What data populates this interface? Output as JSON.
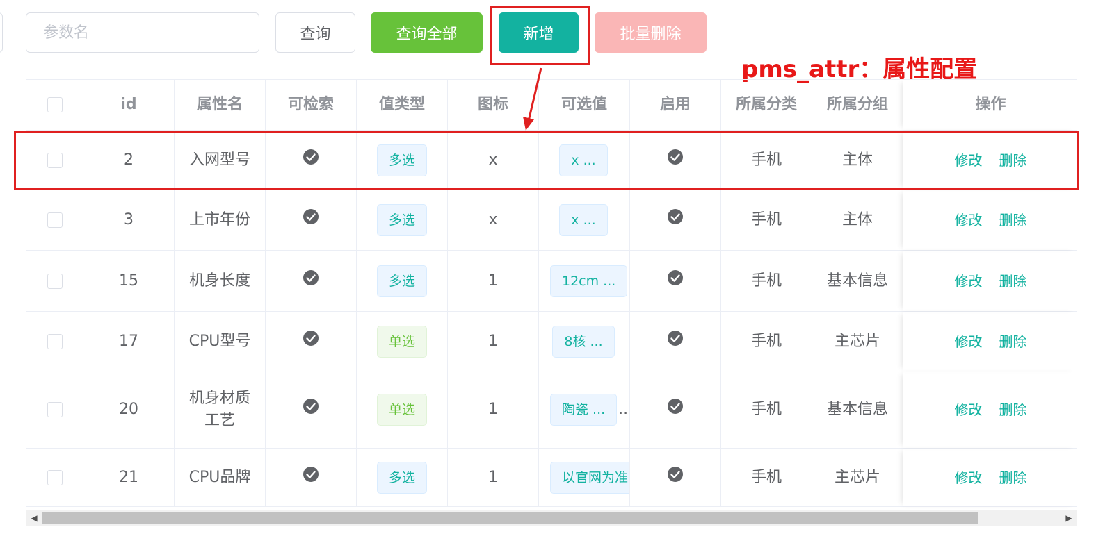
{
  "toolbar": {
    "search_placeholder": "参数名",
    "query_label": "查询",
    "query_all_label": "查询全部",
    "add_label": "新增",
    "batch_delete_label": "批量删除"
  },
  "annotation": {
    "text": "pms_attr：属性配置",
    "color": "#e81818"
  },
  "colors": {
    "primary": "#13b2a0",
    "success": "#67c23a",
    "danger_light": "#fab6b6"
  },
  "table": {
    "headers": [
      "id",
      "属性名",
      "可检索",
      "值类型",
      "图标",
      "可选值",
      "启用",
      "所属分类",
      "所属分组",
      "操作"
    ],
    "rows": [
      {
        "id": "2",
        "name": "入网型号",
        "searchable": "check-circle-icon",
        "type": "多选",
        "type_style": "primary",
        "icon": "x",
        "values": "x ...",
        "values_overflow": "",
        "enabled": "check-circle-icon",
        "category": "手机",
        "group": "主体",
        "edit": "修改",
        "delete": "删除"
      },
      {
        "id": "3",
        "name": "上市年份",
        "searchable": "check-circle-icon",
        "type": "多选",
        "type_style": "primary",
        "icon": "x",
        "values": "x ...",
        "values_overflow": "",
        "enabled": "check-circle-icon",
        "category": "手机",
        "group": "主体",
        "edit": "修改",
        "delete": "删除"
      },
      {
        "id": "15",
        "name": "机身长度",
        "searchable": "check-circle-icon",
        "type": "多选",
        "type_style": "primary",
        "icon": "1",
        "values": "12cm ...",
        "values_overflow": ".",
        "enabled": "check-circle-icon",
        "category": "手机",
        "group": "基本信息",
        "edit": "修改",
        "delete": "删除"
      },
      {
        "id": "17",
        "name": "CPU型号",
        "searchable": "check-circle-icon",
        "type": "单选",
        "type_style": "success",
        "icon": "1",
        "values": "8核 ...",
        "values_overflow": "",
        "enabled": "check-circle-icon",
        "category": "手机",
        "group": "主芯片",
        "edit": "修改",
        "delete": "删除"
      },
      {
        "id": "20",
        "name": "机身材质工艺",
        "searchable": "check-circle-icon",
        "type": "单选",
        "type_style": "success",
        "icon": "1",
        "values": "陶瓷 ...",
        "values_overflow": "..",
        "enabled": "check-circle-icon",
        "category": "手机",
        "group": "基本信息",
        "edit": "修改",
        "delete": "删除"
      },
      {
        "id": "21",
        "name": "CPU品牌",
        "searchable": "check-circle-icon",
        "type": "多选",
        "type_style": "primary",
        "icon": "1",
        "values": "以官网为准",
        "values_overflow": "",
        "enabled": "check-circle-icon",
        "category": "手机",
        "group": "主芯片",
        "edit": "修改",
        "delete": "删除"
      }
    ]
  }
}
